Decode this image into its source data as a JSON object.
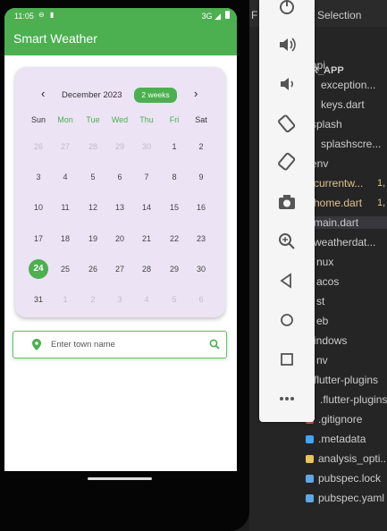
{
  "status_bar": {
    "time": "11:05",
    "network": "3G"
  },
  "app_bar": {
    "title": "Smart Weather"
  },
  "calendar": {
    "month_label": "December 2023",
    "format_button": "2 weeks",
    "weekdays": [
      "Sun",
      "Mon",
      "Tue",
      "Wed",
      "Thu",
      "Fri",
      "Sat"
    ],
    "weeks": [
      [
        "26",
        "27",
        "28",
        "29",
        "30",
        "1",
        "2"
      ],
      [
        "3",
        "4",
        "5",
        "6",
        "7",
        "8",
        "9"
      ],
      [
        "10",
        "11",
        "12",
        "13",
        "14",
        "15",
        "16"
      ],
      [
        "17",
        "18",
        "19",
        "20",
        "21",
        "22",
        "23"
      ],
      [
        "24",
        "25",
        "26",
        "27",
        "28",
        "29",
        "30"
      ],
      [
        "31",
        "1",
        "2",
        "3",
        "4",
        "5",
        "6"
      ]
    ],
    "selected_day": "24"
  },
  "search": {
    "placeholder": "Enter town name"
  },
  "ide": {
    "menu_selection": "Selection",
    "menu_selection_partial": "F",
    "explorer_header": "R",
    "project": "R_APP",
    "items": [
      {
        "label": "api"
      },
      {
        "label": "exception..."
      },
      {
        "label": "keys.dart"
      },
      {
        "label": "splash"
      },
      {
        "label": "splashscre..."
      },
      {
        "label": "env"
      },
      {
        "label": "currentw...",
        "badge": "1,"
      },
      {
        "label": "home.dart",
        "badge": "1,"
      },
      {
        "label": "main.dart"
      },
      {
        "label": "weatherdat..."
      },
      {
        "label": "nux"
      },
      {
        "label": "acos"
      },
      {
        "label": "st"
      },
      {
        "label": "eb"
      },
      {
        "label": "indows"
      },
      {
        "label": "nv"
      },
      {
        "label": "flutter-plugins"
      },
      {
        "label": ".flutter-plugins-..."
      },
      {
        "label": ".gitignore"
      },
      {
        "label": ".metadata"
      },
      {
        "label": "analysis_opti..."
      },
      {
        "label": "pubspec.lock"
      },
      {
        "label": "pubspec.yaml"
      }
    ]
  },
  "colors": {
    "primary": "#4caf50",
    "calendar_bg": "#ece3f5",
    "ide_bg": "#252526",
    "ide_modified": "#e2c08d",
    "ide_folder_text": "#cccccc"
  }
}
